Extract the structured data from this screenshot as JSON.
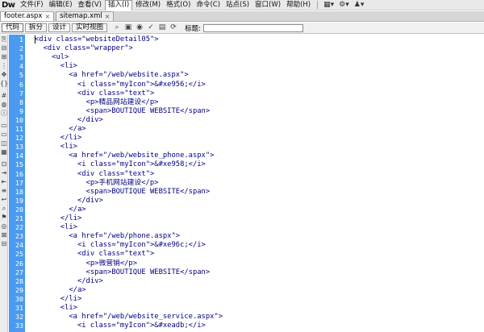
{
  "app": {
    "logo": "Dw",
    "menus": [
      "文件(F)",
      "编辑(E)",
      "查看(V)",
      "插入(I)",
      "修改(M)",
      "格式(O)",
      "命令(C)",
      "站点(S)",
      "窗口(W)",
      "帮助(H)"
    ],
    "active_menu_index": 3
  },
  "tabs": [
    {
      "label": "footer.aspx",
      "close": "×"
    },
    {
      "label": "sitemap.xml",
      "close": "×"
    }
  ],
  "toolbar": {
    "views": [
      "代码",
      "拆分",
      "设计",
      "实时视图"
    ],
    "title_label": "标题:",
    "title_value": ""
  },
  "editor": {
    "lines": [
      "<div class=\"websiteDetail05\">",
      "  <div class=\"wrapper\">",
      "    <ul>",
      "      <li>",
      "        <a href=\"/web/website.aspx\">",
      "          <i class=\"myIcon\">&#xe956;</i>",
      "          <div class=\"text\">",
      "            <p>精品网站建设</p>",
      "            <span>BOUTIQUE WEBSITE</span>",
      "          </div>",
      "        </a>",
      "      </li>",
      "      <li>",
      "        <a href=\"/web/website_phone.aspx\">",
      "          <i class=\"myIcon\">&#xe958;</i>",
      "          <div class=\"text\">",
      "            <p>手机网站建设</p>",
      "            <span>BOUTIQUE WEBSITE</span>",
      "          </div>",
      "        </a>",
      "      </li>",
      "      <li>",
      "        <a href=\"/web/phone.aspx\">",
      "          <i class=\"myIcon\">&#xe96c;</i>",
      "          <div class=\"text\">",
      "            <p>微营销</p>",
      "            <span>BOUTIQUE WEBSITE</span>",
      "          </div>",
      "        </a>",
      "      </li>",
      "      <li>",
      "        <a href=\"/web/website_service.aspx\">",
      "          <i class=\"myIcon\">&#xeadb;</i>"
    ]
  },
  "colors": {
    "gutter": "#4a9bf0",
    "tag": "#000080",
    "text": "#000000"
  }
}
